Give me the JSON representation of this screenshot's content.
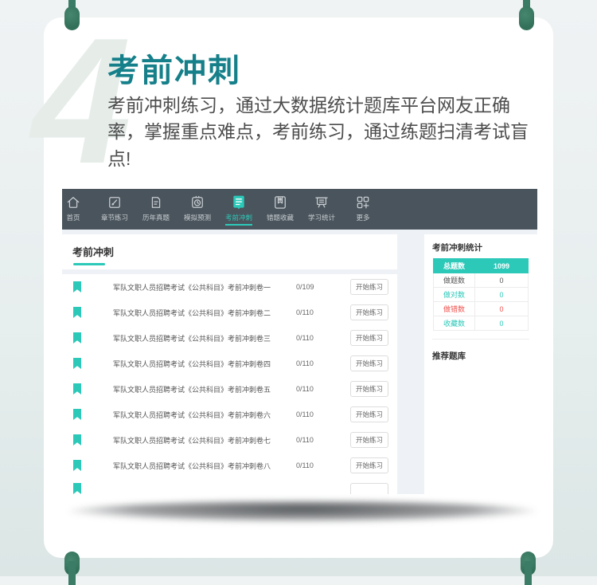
{
  "colors": {
    "accent": "#2cc9b9",
    "title_teal": "#16808a",
    "nav_bg": "#4a545c",
    "nav_inactive": "#c9ced2",
    "red": "#f0534f",
    "pin_green": "#3b7c66",
    "content_bg": "#eef2f7"
  },
  "hero": {
    "watermark_numeral": "4",
    "title": "考前冲刺",
    "description": "考前冲刺练习，通过大数据统计题库平台网友正确率，掌握重点难点，考前练习，通过练题扫清考试盲点!"
  },
  "nav": {
    "items": [
      {
        "label": "首页",
        "icon": "home-icon",
        "active": false
      },
      {
        "label": "章节练习",
        "icon": "chapter-practice-icon",
        "active": false
      },
      {
        "label": "历年真题",
        "icon": "past-papers-icon",
        "active": false
      },
      {
        "label": "模拟预测",
        "icon": "mock-test-icon",
        "active": false
      },
      {
        "label": "考前冲刺",
        "icon": "sprint-icon",
        "active": true
      },
      {
        "label": "错题收藏",
        "icon": "wrong-favorites-icon",
        "active": false
      },
      {
        "label": "学习统计",
        "icon": "study-stats-icon",
        "active": false
      },
      {
        "label": "更多",
        "icon": "more-icon",
        "active": false
      }
    ]
  },
  "list_panel": {
    "heading": "考前冲刺",
    "rows": [
      {
        "title": "军队文职人员招聘考试《公共科目》考前冲刺卷一",
        "progress": "0/109",
        "action": "开始练习"
      },
      {
        "title": "军队文职人员招聘考试《公共科目》考前冲刺卷二",
        "progress": "0/110",
        "action": "开始练习"
      },
      {
        "title": "军队文职人员招聘考试《公共科目》考前冲刺卷三",
        "progress": "0/110",
        "action": "开始练习"
      },
      {
        "title": "军队文职人员招聘考试《公共科目》考前冲刺卷四",
        "progress": "0/110",
        "action": "开始练习"
      },
      {
        "title": "军队文职人员招聘考试《公共科目》考前冲刺卷五",
        "progress": "0/110",
        "action": "开始练习"
      },
      {
        "title": "军队文职人员招聘考试《公共科目》考前冲刺卷六",
        "progress": "0/110",
        "action": "开始练习"
      },
      {
        "title": "军队文职人员招聘考试《公共科目》考前冲刺卷七",
        "progress": "0/110",
        "action": "开始练习"
      },
      {
        "title": "军队文职人员招聘考试《公共科目》考前冲刺卷八",
        "progress": "0/110",
        "action": "开始练习"
      }
    ]
  },
  "stats_panel": {
    "heading": "考前冲刺统计",
    "table": {
      "header_label": "总题数",
      "header_value": "1099",
      "rows": [
        {
          "label": "做题数",
          "value": "0",
          "tone": "default"
        },
        {
          "label": "做对数",
          "value": "0",
          "tone": "teal"
        },
        {
          "label": "做错数",
          "value": "0",
          "tone": "red"
        },
        {
          "label": "收藏数",
          "value": "0",
          "tone": "teal"
        }
      ]
    },
    "recommend_heading": "推荐题库"
  }
}
